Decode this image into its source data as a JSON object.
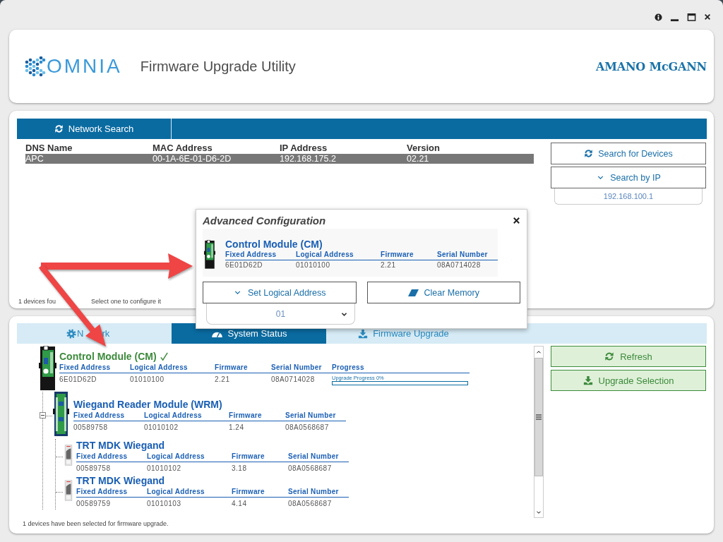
{
  "header": {
    "logo_text": "OMNIA",
    "title": "Firmware Upgrade Utility",
    "brand": "AMANO McGANN"
  },
  "network_panel": {
    "tabs": [
      {
        "label": "Network Search",
        "selected": true
      }
    ],
    "table": {
      "columns": [
        "DNS Name",
        "MAC Address",
        "IP Address",
        "Version"
      ],
      "rows": [
        {
          "cells": [
            "APC",
            "00-1A-6E-01-D6-2D",
            "192.168.175.2",
            "02.21"
          ],
          "selected": true
        }
      ]
    },
    "buttons": [
      {
        "label": "Search for Devices",
        "kind": "refresh"
      },
      {
        "label": "Search by IP",
        "kind": "dropdown"
      }
    ],
    "ip_field": {
      "value": "192.168.100.1"
    },
    "status_parts": [
      "1 devices fou",
      "Select one to configure it"
    ]
  },
  "dialog": {
    "title": "Advanced Configuration",
    "device": {
      "name": "Control Module (CM)",
      "kind": "cm",
      "columns": [
        "Fixed Address",
        "Logical Address",
        "Firmware",
        "Serial Number"
      ],
      "values": [
        "6E01D62D",
        "01010100",
        "2.21",
        "08A0714028"
      ]
    },
    "buttons": [
      {
        "label": "Set Logical Address",
        "kind": "dropdown"
      },
      {
        "label": "Clear Memory",
        "kind": "erase"
      }
    ],
    "address_select": {
      "value": "01"
    }
  },
  "status_panel": {
    "tabs": [
      {
        "label_parts": [
          "N",
          "rk"
        ],
        "kind": "network",
        "selected": false
      },
      {
        "label": "System Status",
        "kind": "status",
        "selected": true
      },
      {
        "label": "Firmware Upgrade",
        "kind": "upgrade",
        "selected": false
      }
    ],
    "tree": [
      {
        "name": "Control Module (CM)",
        "kind": "cm",
        "checked": true,
        "columns": [
          "Fixed Address",
          "Logical Address",
          "Firmware",
          "Serial Number",
          "Progress"
        ],
        "values": [
          "6E01D62D",
          "01010100",
          "2.21",
          "08A0714028"
        ],
        "progress": {
          "label": "Upgrade Progress 0%",
          "level": 0
        },
        "children": [
          {
            "name": "Wiegand Reader Module (WRM)",
            "kind": "wrm",
            "checked": false,
            "expanded": true,
            "columns": [
              "Fixed Address",
              "Logical Address",
              "Firmware",
              "Serial Number"
            ],
            "values": [
              "00589758",
              "01010102",
              "1.24",
              "08A0568687"
            ],
            "children": [
              {
                "name": "TRT MDK Wiegand",
                "kind": "trt",
                "checked": false,
                "columns": [
                  "Fixed Address",
                  "Logical Address",
                  "Firmware",
                  "Serial Number"
                ],
                "values": [
                  "00589758",
                  "01010102",
                  "3.18",
                  "08A0568687"
                ]
              },
              {
                "name": "TRT MDK Wiegand",
                "kind": "trt",
                "checked": false,
                "columns": [
                  "Fixed Address",
                  "Logical Address",
                  "Firmware",
                  "Serial Number"
                ],
                "values": [
                  "00589759",
                  "01010103",
                  "4.14",
                  "08A0568687"
                ]
              }
            ]
          }
        ]
      }
    ],
    "buttons": [
      {
        "label": "Refresh",
        "kind": "refresh"
      },
      {
        "label": "Upgrade Selection",
        "kind": "download"
      }
    ],
    "status": "1 devices have been selected for firmware upgrade."
  }
}
